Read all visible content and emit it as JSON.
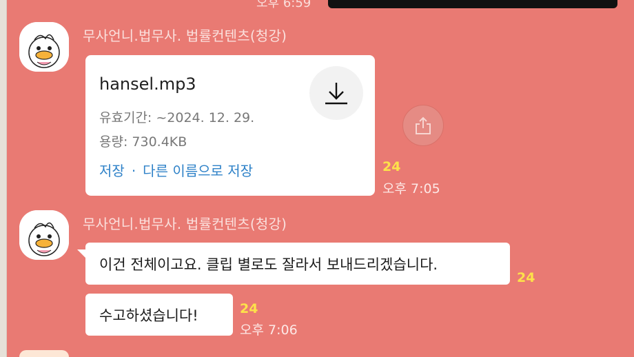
{
  "top": {
    "time_partial": "오후 6:59"
  },
  "messages": [
    {
      "sender": "무사언니.법무사. 법률컨텐츠(청강)",
      "file": {
        "name": "hansel.mp3",
        "expiry": "유효기간: ~2024. 12. 29.",
        "size": "용량: 730.4KB",
        "save": "저장",
        "separator": "·",
        "save_as": "다른 이름으로 저장"
      },
      "unread": "24",
      "time": "오후 7:05"
    },
    {
      "sender": "무사언니.법무사. 법률컨텐츠(청강)",
      "bubbles": [
        {
          "text": "이건 전체이고요. 클립 별로도 잘라서 보내드리겠습니다.",
          "unread": "24"
        },
        {
          "text": "수고하셨습니다!",
          "unread": "24",
          "time": "오후 7:06"
        }
      ]
    }
  ],
  "colors": {
    "background": "#e97a73",
    "unread": "#fde14a",
    "link": "#2f82c8"
  },
  "icons": [
    "download-icon",
    "share-icon",
    "avatar-duck"
  ]
}
